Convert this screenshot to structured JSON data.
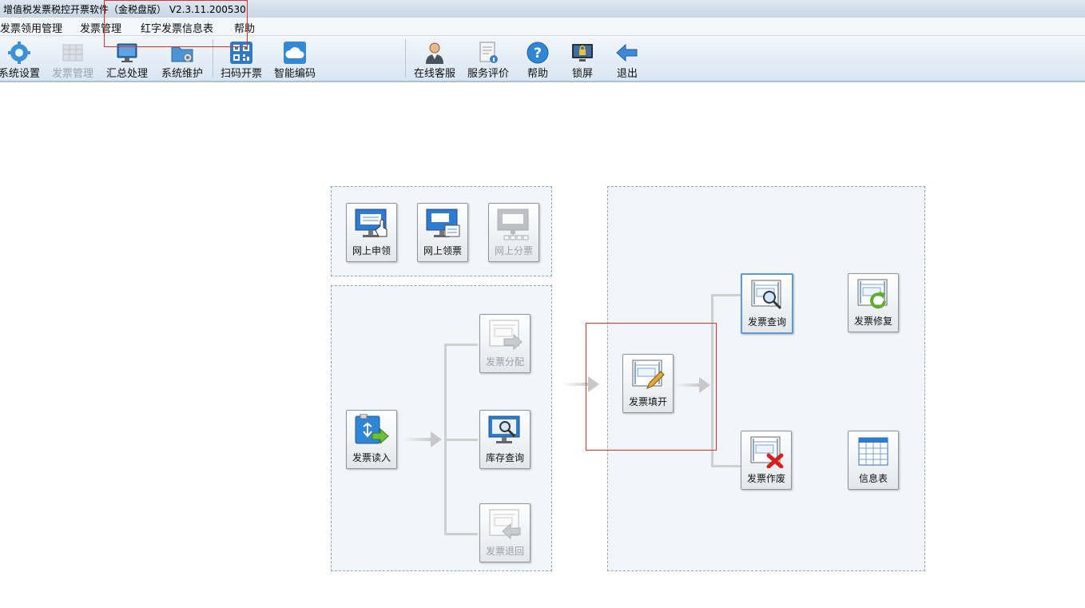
{
  "window": {
    "title": "增值税发票税控开票软件（金税盘版） V2.3.11.200530"
  },
  "menu": {
    "items": [
      "发票领用管理",
      "发票管理",
      "红字发票信息表",
      "帮助"
    ]
  },
  "toolbar": {
    "left": [
      {
        "label": "系统设置",
        "icon": "gear-icon",
        "enabled": true
      },
      {
        "label": "发票管理",
        "icon": "invoice-grid-icon",
        "enabled": false
      },
      {
        "label": "汇总处理",
        "icon": "monitor-icon",
        "enabled": true
      },
      {
        "label": "系统维护",
        "icon": "folder-gear-icon",
        "enabled": true
      },
      {
        "label": "扫码开票",
        "icon": "qrcode-icon",
        "enabled": true
      },
      {
        "label": "智能编码",
        "icon": "cloud-icon",
        "enabled": true
      }
    ],
    "right": [
      {
        "label": "在线客服",
        "icon": "person-icon",
        "enabled": true
      },
      {
        "label": "服务评价",
        "icon": "document-rating-icon",
        "enabled": true
      },
      {
        "label": "帮助",
        "icon": "help-icon",
        "enabled": true
      },
      {
        "label": "锁屏",
        "icon": "lock-screen-icon",
        "enabled": true
      },
      {
        "label": "退出",
        "icon": "exit-arrow-icon",
        "enabled": true
      }
    ]
  },
  "online": {
    "apply": "网上申领",
    "receive": "网上领票",
    "distribute": "网上分票"
  },
  "stock": {
    "read": "发票读入",
    "allocate": "发票分配",
    "inventory": "库存查询",
    "return": "发票退回"
  },
  "issue": {
    "fill": "发票填开",
    "query": "发票查询",
    "repair": "发票修复",
    "void": "发票作废",
    "info_table": "信息表"
  }
}
